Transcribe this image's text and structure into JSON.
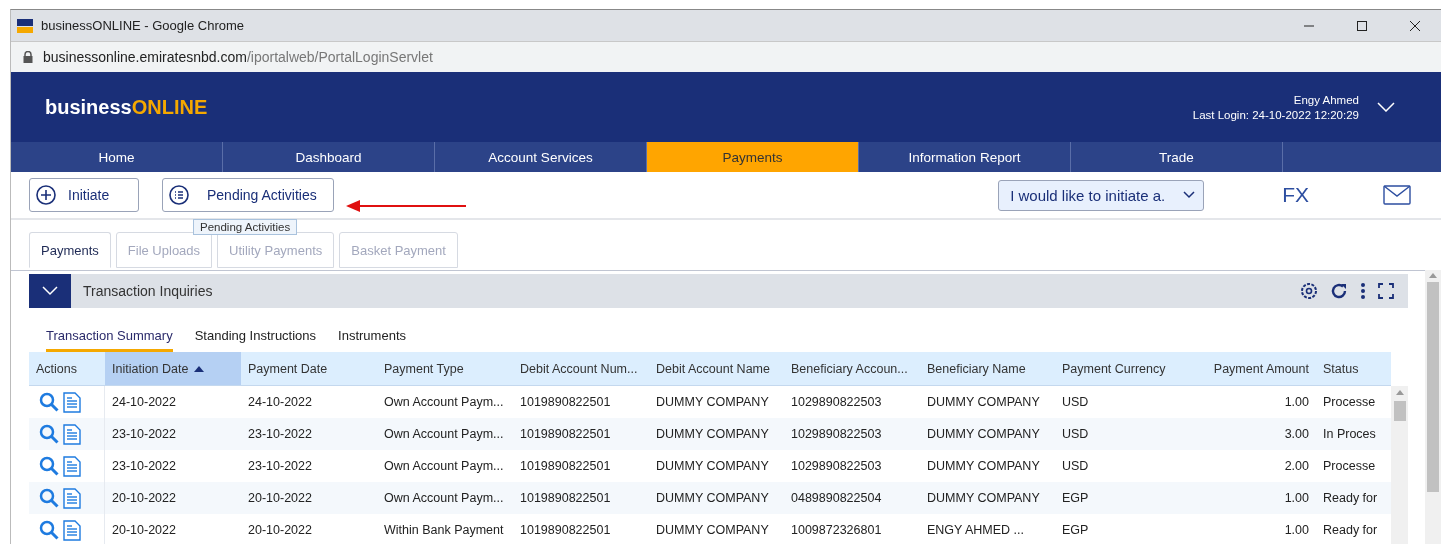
{
  "window": {
    "title": "businessONLINE - Google Chrome"
  },
  "address_bar": {
    "host": "businessonline.emiratesnbd.com",
    "path": "/iportalweb/PortalLoginServlet"
  },
  "header": {
    "logo": {
      "brand": "business",
      "highlight": "ONLINE"
    },
    "user": "Engy Ahmed",
    "last_login": "Last Login: 24-10-2022 12:20:29"
  },
  "nav": [
    {
      "label": "Home",
      "selected": false
    },
    {
      "label": "Dashboard",
      "selected": false
    },
    {
      "label": "Account Services",
      "selected": false
    },
    {
      "label": "Payments",
      "selected": true
    },
    {
      "label": "Information Report",
      "selected": false
    },
    {
      "label": "Trade",
      "selected": false
    }
  ],
  "toolbar": {
    "initiate": "Initiate",
    "pending": "Pending Activities",
    "tooltip": "Pending Activities",
    "dropdown": "I would like to initiate a.",
    "fx": "FX"
  },
  "sub_tabs": [
    {
      "label": "Payments",
      "selected": true,
      "disabled": false
    },
    {
      "label": "File Uploads",
      "selected": false,
      "disabled": true
    },
    {
      "label": "Utility Payments",
      "selected": false,
      "disabled": true
    },
    {
      "label": "Basket Payment",
      "selected": false,
      "disabled": true
    }
  ],
  "panel": {
    "title": "Transaction Inquiries",
    "expanded": true
  },
  "inner_tabs": [
    {
      "label": "Transaction Summary",
      "selected": true
    },
    {
      "label": "Standing Instructions",
      "selected": false
    },
    {
      "label": "Instruments",
      "selected": false
    }
  ],
  "table": {
    "columns": [
      {
        "label": "Actions",
        "sorted": false
      },
      {
        "label": "Initiation Date",
        "sorted": true
      },
      {
        "label": "Payment Date",
        "sorted": false
      },
      {
        "label": "Payment Type",
        "sorted": false
      },
      {
        "label": "Debit Account Num...",
        "sorted": false
      },
      {
        "label": "Debit Account Name",
        "sorted": false
      },
      {
        "label": "Beneficiary Accoun...",
        "sorted": false
      },
      {
        "label": "Beneficiary Name",
        "sorted": false
      },
      {
        "label": "Payment Currency",
        "sorted": false
      },
      {
        "label": "Payment Amount",
        "sorted": false
      },
      {
        "label": "Status",
        "sorted": false
      }
    ],
    "rows": [
      [
        "",
        "24-10-2022",
        "24-10-2022",
        "Own Account Paym...",
        "1019890822501",
        "DUMMY COMPANY",
        "1029890822503",
        "DUMMY COMPANY",
        "USD",
        "1.00",
        "Processe"
      ],
      [
        "",
        "23-10-2022",
        "23-10-2022",
        "Own Account Paym...",
        "1019890822501",
        "DUMMY COMPANY",
        "1029890822503",
        "DUMMY COMPANY",
        "USD",
        "3.00",
        "In Proces"
      ],
      [
        "",
        "23-10-2022",
        "23-10-2022",
        "Own Account Paym...",
        "1019890822501",
        "DUMMY COMPANY",
        "1029890822503",
        "DUMMY COMPANY",
        "USD",
        "2.00",
        "Processe"
      ],
      [
        "",
        "20-10-2022",
        "20-10-2022",
        "Own Account Paym...",
        "1019890822501",
        "DUMMY COMPANY",
        "0489890822504",
        "DUMMY COMPANY",
        "EGP",
        "1.00",
        "Ready for"
      ],
      [
        "",
        "20-10-2022",
        "20-10-2022",
        "Within Bank Payment",
        "1019890822501",
        "DUMMY COMPANY",
        "1009872326801",
        "ENGY AHMED ...",
        "EGP",
        "1.00",
        "Ready for"
      ]
    ]
  }
}
